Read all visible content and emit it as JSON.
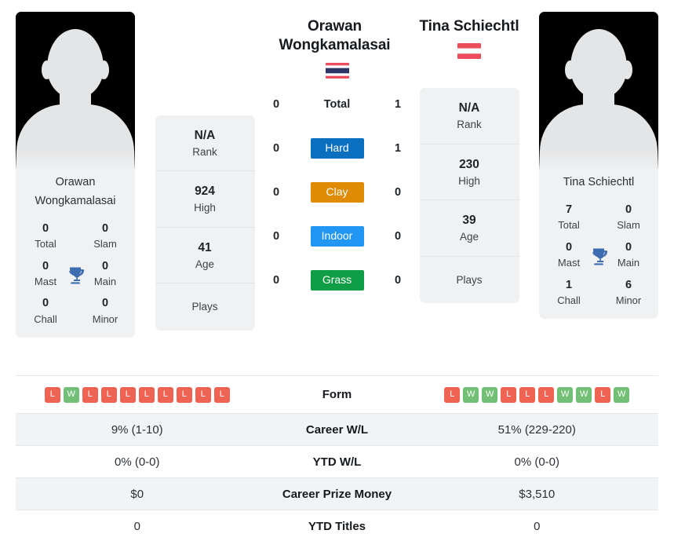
{
  "players": {
    "left": {
      "name": "Orawan Wongkamalasai",
      "card_name_line1": "Orawan",
      "card_name_line2": "Wongkamalasai",
      "flag": "thailand-flag",
      "rank": "N/A",
      "rank_label": "Rank",
      "high": "924",
      "high_label": "High",
      "age": "41",
      "age_label": "Age",
      "plays_label": "Plays",
      "plays_value": "",
      "titles": [
        {
          "num": "0",
          "label": "Total"
        },
        {
          "num": "0",
          "label": "Slam"
        },
        {
          "num": "0",
          "label": "Mast"
        },
        {
          "num": "0",
          "label": "Main"
        },
        {
          "num": "0",
          "label": "Chall"
        },
        {
          "num": "0",
          "label": "Minor"
        }
      ],
      "form": [
        "L",
        "W",
        "L",
        "L",
        "L",
        "L",
        "L",
        "L",
        "L",
        "L"
      ],
      "career_wl": "9% (1-10)",
      "ytd_wl": "0% (0-0)",
      "career_prize_money": "$0",
      "ytd_titles": "0",
      "surface_wins": {
        "total": "0",
        "hard": "0",
        "clay": "0",
        "indoor": "0",
        "grass": "0"
      }
    },
    "right": {
      "name": "Tina Schiechtl",
      "card_name_line1": "Tina Schiechtl",
      "card_name_line2": "",
      "flag": "austria-flag",
      "rank": "N/A",
      "rank_label": "Rank",
      "high": "230",
      "high_label": "High",
      "age": "39",
      "age_label": "Age",
      "plays_label": "Plays",
      "plays_value": "",
      "titles": [
        {
          "num": "7",
          "label": "Total"
        },
        {
          "num": "0",
          "label": "Slam"
        },
        {
          "num": "0",
          "label": "Mast"
        },
        {
          "num": "0",
          "label": "Main"
        },
        {
          "num": "1",
          "label": "Chall"
        },
        {
          "num": "6",
          "label": "Minor"
        }
      ],
      "form": [
        "L",
        "W",
        "W",
        "L",
        "L",
        "L",
        "W",
        "W",
        "L",
        "W"
      ],
      "career_wl": "51% (229-220)",
      "ytd_wl": "0% (0-0)",
      "career_prize_money": "$3,510",
      "ytd_titles": "0",
      "surface_wins": {
        "total": "1",
        "hard": "1",
        "clay": "0",
        "indoor": "0",
        "grass": "0"
      }
    }
  },
  "surfaces": [
    {
      "key": "total",
      "label": "Total",
      "style": "plain",
      "color": ""
    },
    {
      "key": "hard",
      "label": "Hard",
      "style": "badge",
      "color": "#0b6fbf"
    },
    {
      "key": "clay",
      "label": "Clay",
      "style": "badge",
      "color": "#df8c04"
    },
    {
      "key": "indoor",
      "label": "Indoor",
      "style": "badge",
      "color": "#2196f3"
    },
    {
      "key": "grass",
      "label": "Grass",
      "style": "badge",
      "color": "#0f9d45"
    }
  ],
  "stats_rows": [
    {
      "label": "Form",
      "type": "form"
    },
    {
      "label": "Career W/L",
      "type": "text",
      "key": "career_wl"
    },
    {
      "label": "YTD W/L",
      "type": "text",
      "key": "ytd_wl"
    },
    {
      "label": "Career Prize Money",
      "type": "text",
      "key": "career_prize_money"
    },
    {
      "label": "YTD Titles",
      "type": "text",
      "key": "ytd_titles"
    }
  ],
  "colors": {
    "win_badge": "#72c078",
    "loss_badge": "#ee6352",
    "trophy": "#3d6cb0",
    "card_bg": "#f0f1f2",
    "row_shaded": "#f2f3f4"
  }
}
